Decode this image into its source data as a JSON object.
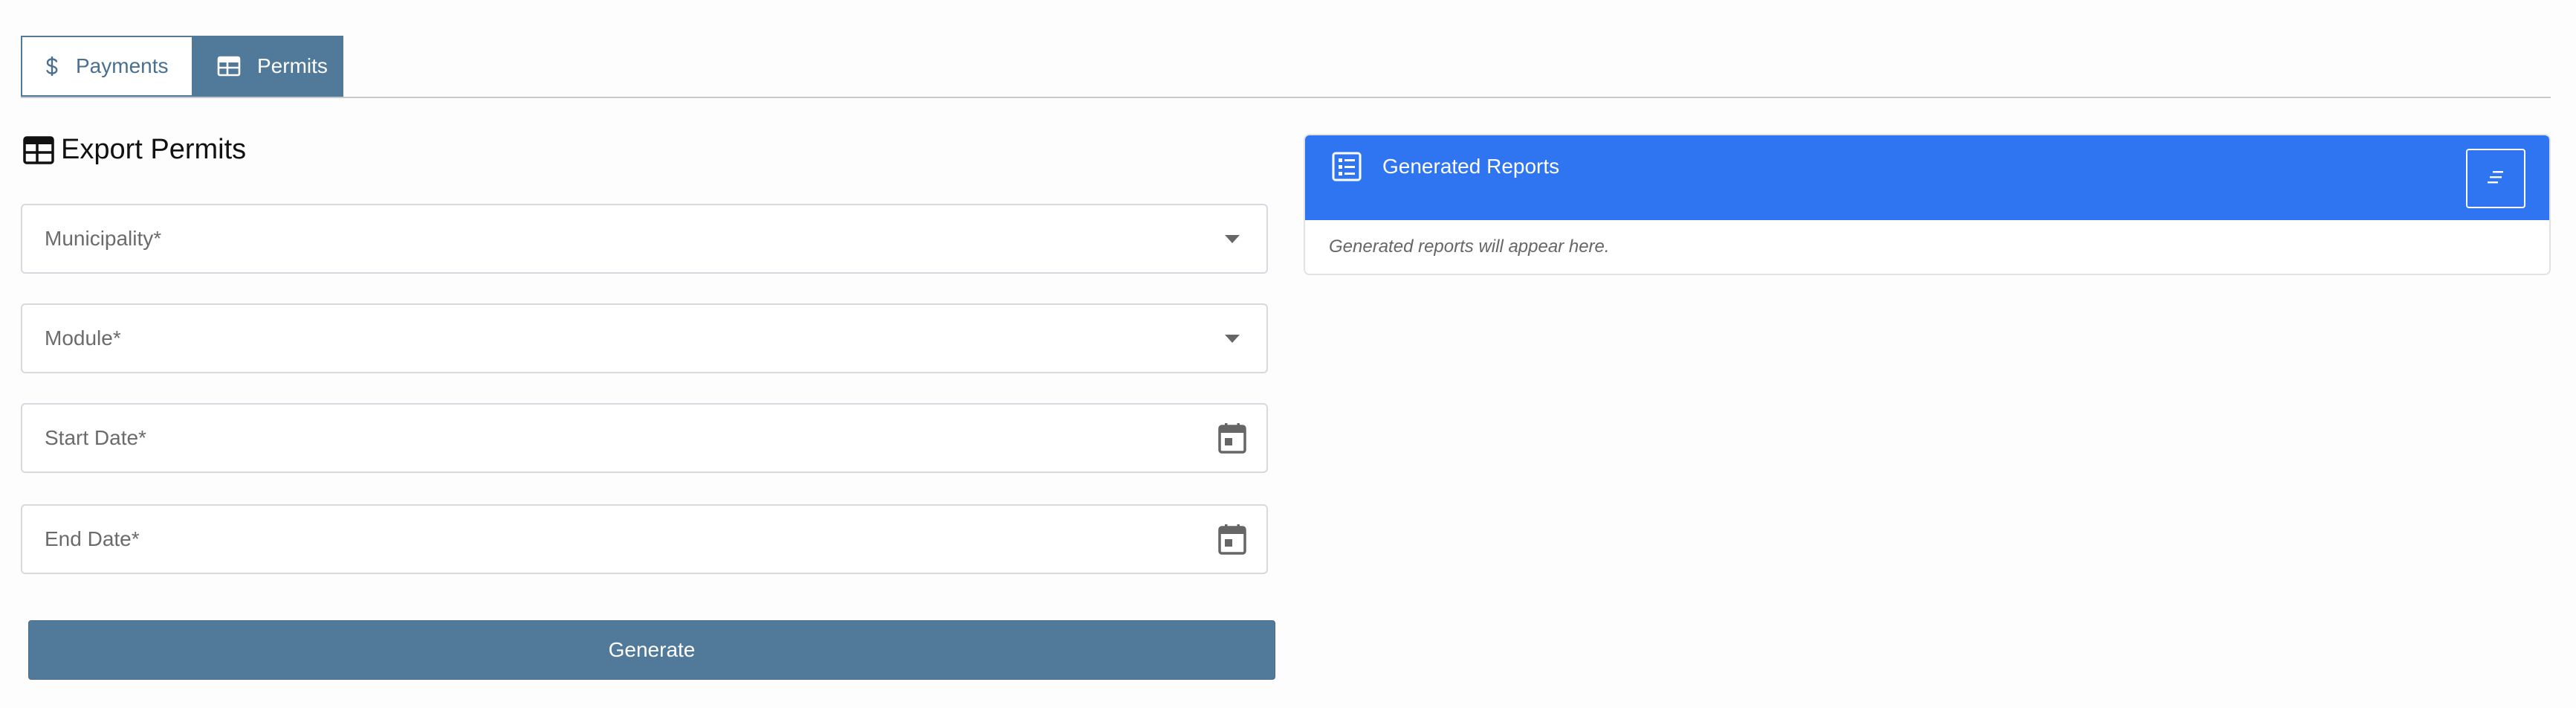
{
  "tabs": {
    "payments": {
      "label": "Payments",
      "icon": "dollar-icon"
    },
    "permits": {
      "label": "Permits",
      "icon": "table-icon",
      "active": true
    }
  },
  "export": {
    "title": "Export Permits",
    "title_icon": "table-icon",
    "fields": {
      "municipality": {
        "label": "Municipality*"
      },
      "module": {
        "label": "Module*"
      },
      "start_date": {
        "label": "Start Date*"
      },
      "end_date": {
        "label": "End Date*"
      }
    },
    "generate_label": "Generate"
  },
  "reports": {
    "title": "Generated Reports",
    "empty_text": "Generated reports will appear here.",
    "header_color": "#2f74f0"
  },
  "colors": {
    "primary": "#51799a",
    "accent": "#2f74f0"
  }
}
